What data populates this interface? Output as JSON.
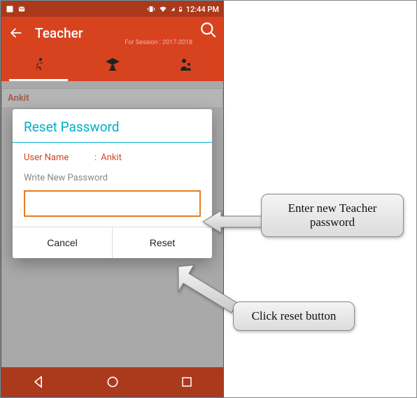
{
  "status": {
    "time": "12:44 PM"
  },
  "appbar": {
    "title": "Teacher",
    "session_label": "For Session : 2017-2018"
  },
  "list": {
    "name": "Ankit"
  },
  "dialog": {
    "title": "Reset Password",
    "username_label": "User Name",
    "colon": ":",
    "username_value": "Ankit",
    "hint": "Write New Password",
    "password_value": "",
    "cancel": "Cancel",
    "reset": "Reset"
  },
  "callouts": {
    "enter_pw": "Enter new Teacher password",
    "click_reset": "Click reset button"
  }
}
